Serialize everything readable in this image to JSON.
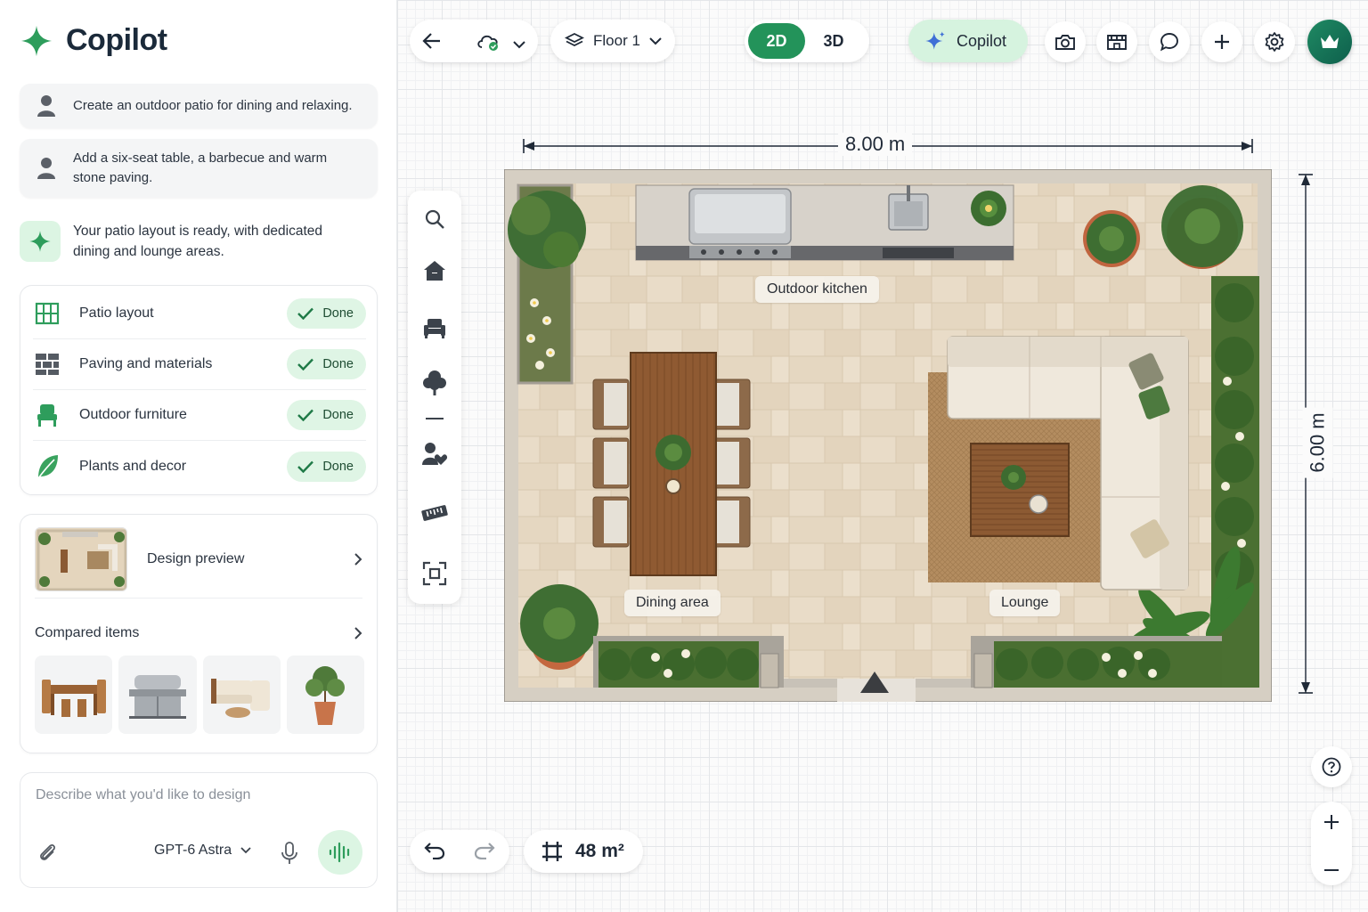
{
  "sidebar": {
    "title": "Copilot",
    "messages": [
      "Create an outdoor patio for dining and relaxing.",
      "Add a six-seat table, a barbecue and warm stone paving."
    ],
    "assistant_reply": "Your patio layout is ready, with dedicated dining and lounge areas.",
    "tasks": [
      {
        "label": "Patio layout",
        "status": "Done",
        "icon": "grid-icon"
      },
      {
        "label": "Paving and materials",
        "status": "Done",
        "icon": "bricks-icon"
      },
      {
        "label": "Outdoor furniture",
        "status": "Done",
        "icon": "chair-icon"
      },
      {
        "label": "Plants and decor",
        "status": "Done",
        "icon": "leaf-icon"
      }
    ],
    "preview": {
      "design_preview_label": "Design preview",
      "compared_items_label": "Compared items",
      "items": [
        "dining-set",
        "barbecue-grill",
        "sectional-sofa",
        "potted-plant"
      ]
    },
    "composer": {
      "placeholder": "Describe what you'd like to design",
      "model": "GPT-6 Astra"
    }
  },
  "toolbar": {
    "floor": "Floor 1",
    "view_2d": "2D",
    "view_3d": "3D",
    "copilot": "Copilot"
  },
  "plan": {
    "width_label": "8.00 m",
    "height_label": "6.00 m",
    "rooms": [
      "Outdoor kitchen",
      "Dining area",
      "Lounge"
    ],
    "area": "48 m²"
  },
  "colors": {
    "accent_green": "#23935a",
    "accent_light": "#dcf5e3",
    "paving": "#e6d8c3",
    "wood": "#8a5a34"
  }
}
